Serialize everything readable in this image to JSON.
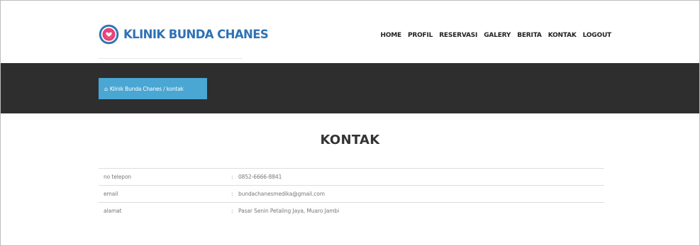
{
  "brand": {
    "name": "KLINIK BUNDA CHANES",
    "color": "#2f72b5"
  },
  "nav": {
    "items": [
      "HOME",
      "PROFIL",
      "RESERVASI",
      "GALERY",
      "BERITA",
      "KONTAK",
      "LOGOUT"
    ]
  },
  "breadcrumb": {
    "icon": "home-icon",
    "text": "Klinik Bunda Chanes / kontak",
    "color": "#4aa6d3"
  },
  "page": {
    "title": "KONTAK"
  },
  "contact": {
    "rows": [
      {
        "label": "no telepon",
        "separator": ":",
        "value": "0852-6666-8841"
      },
      {
        "label": "email",
        "separator": ":",
        "value": "bundachanesmedika@gmail.com"
      },
      {
        "label": "alamat",
        "separator": ":",
        "value": "Pasar Senin Petaling Jaya, Muaro Jambi"
      }
    ]
  },
  "colors": {
    "band": "#2e2e2e",
    "text_dark": "#333333",
    "text_muted": "#777777"
  }
}
